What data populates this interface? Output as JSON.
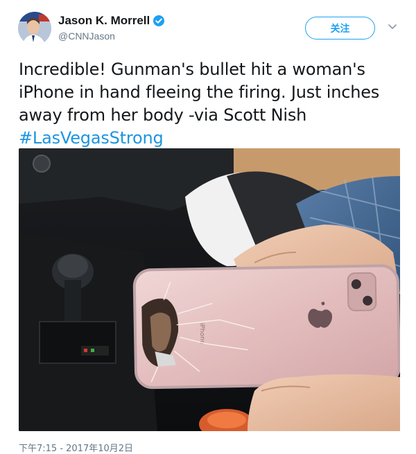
{
  "author": {
    "display_name": "Jason K. Morrell",
    "handle": "@CNNJason",
    "verified": true,
    "avatar": "avatar-photo"
  },
  "actions": {
    "follow_label": "关注",
    "more_icon": "chevron-down-icon"
  },
  "tweet": {
    "text": "Incredible! Gunman's bullet hit a woman's iPhone in hand fleeing the firing. Just inches away from her body -via Scott Nish",
    "hashtag": "#LasVegasStrong",
    "timestamp": "下午7:15 - 2017年10月2日"
  },
  "media": {
    "photo_text": "iPhone"
  },
  "colors": {
    "accent": "#1da1f2",
    "hashtag": "#1b95e0",
    "secondary_text": "#657786",
    "primary_text": "#14171a"
  }
}
